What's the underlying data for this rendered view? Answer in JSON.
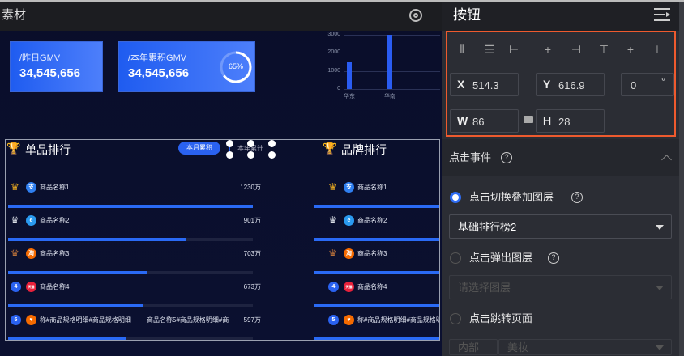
{
  "canvas": {
    "title": "素材",
    "settings_icon": "gear-icon"
  },
  "cards": [
    {
      "label": "/昨日GMV",
      "value": "34,545,656"
    },
    {
      "label": "/本年累积GMV",
      "value": "34,545,656",
      "progress_label": "65%",
      "progress": 0.65
    }
  ],
  "chart_data": {
    "type": "bar",
    "categories": [
      "华东",
      "华南"
    ],
    "values": [
      1500,
      3000
    ],
    "yticks": [
      "3000",
      "2000",
      "1000",
      "0"
    ],
    "ylim": [
      0,
      3000
    ]
  },
  "ranking": {
    "title": "单品排行",
    "brand_title": "品牌排行",
    "tab_month": "本月累积",
    "tab_year": "本年累计",
    "items": [
      {
        "rank": "1",
        "name": "商品名称1",
        "value": "1230万",
        "pct": 1.0,
        "icon_color": "#2f7ff0",
        "icon": "支"
      },
      {
        "rank": "2",
        "name": "商品名称2",
        "value": "901万",
        "pct": 0.73,
        "icon_color": "#2a9af0",
        "icon": "e"
      },
      {
        "rank": "3",
        "name": "商品名称3",
        "value": "703万",
        "pct": 0.57,
        "icon_color": "#f56a00",
        "icon": "淘"
      },
      {
        "rank": "4",
        "name": "商品名称4",
        "value": "673万",
        "pct": 0.55,
        "icon_color": "#e8213b",
        "icon": "天猫"
      },
      {
        "rank": "5",
        "name": "称#商品规格明细#商品规格明细",
        "name2": "商品名称5#商品规格明细#商",
        "value": "597万",
        "pct": 0.485,
        "icon_color": "#f56a00",
        "icon": "♥"
      }
    ],
    "brand_items": [
      {
        "rank": "1",
        "name": "商品名称1"
      },
      {
        "rank": "2",
        "name": "商品名称2"
      },
      {
        "rank": "3",
        "name": "商品名称3"
      },
      {
        "rank": "4",
        "name": "商品名称4"
      },
      {
        "rank": "5",
        "name": "称#商品规格明细#商品规格明细"
      }
    ]
  },
  "panel": {
    "title": "按钮",
    "x_label": "X",
    "x": "514.3",
    "y_label": "Y",
    "y": "616.9",
    "rotation": "0",
    "deg": "°",
    "w_label": "W",
    "w": "86",
    "h_label": "H",
    "h": "28",
    "section": "点击事件",
    "opt1": "点击切换叠加图层",
    "opt1_select": "基础排行榜2",
    "opt2": "点击弹出图层",
    "opt2_placeholder": "请选择图层",
    "opt3": "点击跳转页面",
    "opt3_type": "内部",
    "opt3_page": "美妆",
    "q": "?"
  }
}
